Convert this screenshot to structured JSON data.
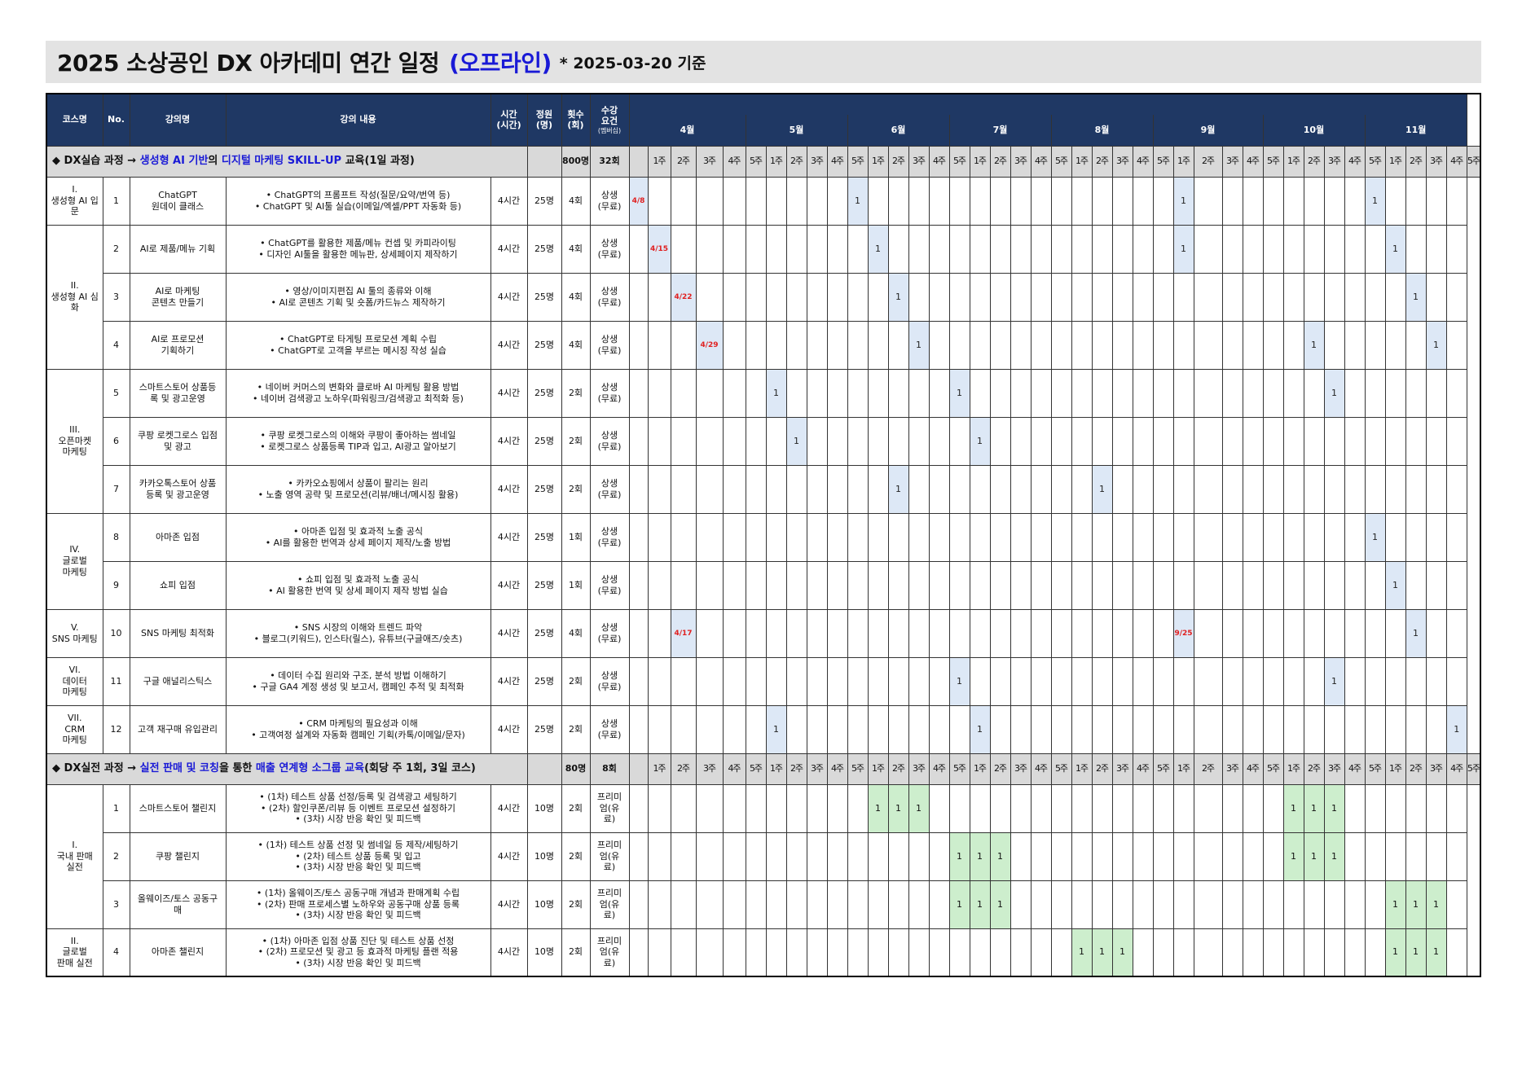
{
  "page": {
    "title": "2025 소상공인 DX 아카데미 연간 일정",
    "title_accent": "(오프라인)",
    "note": "* 2025-03-20 기준",
    "accent_color": "#1a1ad6"
  },
  "headers": {
    "course": "코스명",
    "no": "No.",
    "lecture": "강의명",
    "content": "강의 내용",
    "hours": "시간\n(시간)",
    "capacity": "정원\n(명)",
    "count": "횟수\n(회)",
    "req": "수강\n요건",
    "req_sub": "(멤버십)",
    "months": [
      "4월",
      "5월",
      "6월",
      "7월",
      "8월",
      "9월",
      "10월",
      "11월"
    ],
    "weeks": [
      "1주",
      "2주",
      "3주",
      "4주",
      "5주",
      "1주",
      "2주",
      "3주",
      "4주",
      "5주",
      "1주",
      "2주",
      "3주",
      "4주",
      "5주",
      "1주",
      "2주",
      "3주",
      "4주",
      "5주",
      "1주",
      "2주",
      "3주",
      "4주",
      "5주",
      "1주",
      "2주",
      "3주",
      "4주",
      "5주",
      "1주",
      "2주",
      "3주",
      "4주",
      "5주",
      "1주",
      "2주",
      "3주",
      "4주",
      "5주"
    ]
  },
  "section1": {
    "prefix": "◆ DX실습 과정 → ",
    "blue1": "생성형 AI 기반",
    "mid": "의 ",
    "blue2": "디지털 마케팅 SKILL-UP",
    "suffix": " 교육(1일 과정)",
    "capacity": "800명",
    "count": "32회"
  },
  "section2": {
    "prefix": "◆ DX실전 과정 → ",
    "blue1": "실전 판매 및 코칭",
    "mid": "을 통한 ",
    "blue2": "매출 연계형 소그룹 교육",
    "suffix": "(회당 주 1회, 3일 코스)",
    "capacity": "80명",
    "count": "8회"
  },
  "rows1": [
    {
      "course": "I.\n생성형 AI 입문",
      "span": 1,
      "no": "1",
      "name": "ChatGPT\n원데이 클래스",
      "content": "• ChatGPT의 프롬프트 작성(질문/요약/번역 등)\n• ChatGPT 및 AI툴 실습(이메일/엑셀/PPT 자동화 등)",
      "hours": "4시간",
      "cap": "25명",
      "cnt": "4회",
      "req": "상생\n(무료)",
      "marks": [
        [
          1,
          "4/8"
        ],
        [
          11,
          "1"
        ],
        [
          27,
          "1"
        ],
        [
          36,
          "1"
        ]
      ]
    },
    {
      "course": "II.\n생성형 AI 심화",
      "span": 3,
      "no": "2",
      "name": "AI로 제품/메뉴 기획",
      "content": "• ChatGPT를 활용한 제품/메뉴 컨셉 및 카피라이팅\n• 디자인 AI툴을 활용한 메뉴판, 상세페이지 제작하기",
      "hours": "4시간",
      "cap": "25명",
      "cnt": "4회",
      "req": "상생\n(무료)",
      "marks": [
        [
          2,
          "4/15"
        ],
        [
          12,
          "1"
        ],
        [
          27,
          "1"
        ],
        [
          37,
          "1"
        ]
      ]
    },
    {
      "no": "3",
      "name": "AI로 마케팅\n콘텐츠 만들기",
      "content": "• 영상/이미지편집 AI 툴의 종류와 이해\n• AI로 콘텐츠 기획 및 숏폼/카드뉴스 제작하기",
      "hours": "4시간",
      "cap": "25명",
      "cnt": "4회",
      "req": "상생\n(무료)",
      "marks": [
        [
          3,
          "4/22"
        ],
        [
          13,
          "1"
        ],
        [
          38,
          "1"
        ]
      ]
    },
    {
      "no": "4",
      "name": "AI로 프로모션\n기획하기",
      "content": "• ChatGPT로 타게팅 프로모션 계획 수립\n• ChatGPT로 고객을 부르는 메시징 작성 실습",
      "hours": "4시간",
      "cap": "25명",
      "cnt": "4회",
      "req": "상생\n(무료)",
      "marks": [
        [
          4,
          "4/29"
        ],
        [
          14,
          "1"
        ],
        [
          33,
          "1"
        ],
        [
          39,
          "1"
        ]
      ]
    },
    {
      "course": "III.\n오픈마켓\n마케팅",
      "span": 3,
      "no": "5",
      "name": "스마트스토어 상품등\n록 및 광고운영",
      "content": "• 네이버 커머스의 변화와 클로바 AI 마케팅 활용 방법\n• 네이버 검색광고 노하우(파워링크/검색광고 최적화 등)",
      "hours": "4시간",
      "cap": "25명",
      "cnt": "2회",
      "req": "상생\n(무료)",
      "marks": [
        [
          7,
          "1"
        ],
        [
          16,
          "1"
        ],
        [
          34,
          "1"
        ]
      ]
    },
    {
      "no": "6",
      "name": "쿠팡 로켓그로스 입점\n및 광고",
      "content": "• 쿠팡 로켓그로스의 이해와 쿠팡이 좋아하는 썸네일\n• 로켓그로스 상품등록 TIP과 입고, AI광고 알아보기",
      "hours": "4시간",
      "cap": "25명",
      "cnt": "2회",
      "req": "상생\n(무료)",
      "marks": [
        [
          8,
          "1"
        ],
        [
          17,
          "1"
        ]
      ]
    },
    {
      "no": "7",
      "name": "카카오톡스토어 상품\n등록 및 광고운영",
      "content": "• 카카오쇼핑에서 상품이 팔리는 원리\n• 노출 영역 공략 및 프로모션(리뷰/배너/메시징 활용)",
      "hours": "4시간",
      "cap": "25명",
      "cnt": "2회",
      "req": "상생\n(무료)",
      "marks": [
        [
          13,
          "1"
        ],
        [
          23,
          "1"
        ]
      ]
    },
    {
      "course": "IV.\n글로벌\n마케팅",
      "span": 2,
      "no": "8",
      "name": "아마존 입점",
      "content": "• 아마존 입점 및 효과적 노출 공식\n• AI를 활용한 번역과 상세 페이지 제작/노출 방법",
      "hours": "4시간",
      "cap": "25명",
      "cnt": "1회",
      "req": "상생\n(무료)",
      "marks": [
        [
          36,
          "1"
        ]
      ]
    },
    {
      "no": "9",
      "name": "쇼피 입점",
      "content": "• 쇼피 입점 및 효과적 노출 공식\n• AI 활용한 번역 및 상세 페이지 제작 방법 실습",
      "hours": "4시간",
      "cap": "25명",
      "cnt": "1회",
      "req": "상생\n(무료)",
      "marks": [
        [
          37,
          "1"
        ]
      ]
    },
    {
      "course": "V.\nSNS 마케팅",
      "span": 1,
      "no": "10",
      "name": "SNS 마케팅 최적화",
      "content": "• SNS 시장의 이해와 트렌드 파악\n• 블로그(키워드), 인스타(릴스), 유튜브(구글애즈/숏츠)",
      "hours": "4시간",
      "cap": "25명",
      "cnt": "4회",
      "req": "상생\n(무료)",
      "marks": [
        [
          3,
          "4/17"
        ],
        [
          27,
          "9/25"
        ],
        [
          38,
          "1"
        ]
      ]
    },
    {
      "course": "VI.\n데이터\n마케팅",
      "span": 1,
      "no": "11",
      "name": "구글 애널리스틱스",
      "content": "• 데이터 수집 원리와 구조, 분석 방법 이해하기\n• 구글 GA4 계정 생성 및 보고서, 캠페인 추적 및 최적화",
      "hours": "4시간",
      "cap": "25명",
      "cnt": "2회",
      "req": "상생\n(무료)",
      "marks": [
        [
          16,
          "1"
        ],
        [
          34,
          "1"
        ]
      ]
    },
    {
      "course": "VII.\nCRM\n마케팅",
      "span": 1,
      "no": "12",
      "name": "고객 재구매 유입관리",
      "content": "• CRM 마케팅의 필요성과 이해\n• 고객여정 설계와 자동화 캠페인 기획(카톡/이메일/문자)",
      "hours": "4시간",
      "cap": "25명",
      "cnt": "2회",
      "req": "상생\n(무료)",
      "marks": [
        [
          7,
          "1"
        ],
        [
          17,
          "1"
        ],
        [
          40,
          "1"
        ]
      ]
    }
  ],
  "rows2": [
    {
      "course": "I.\n국내 판매\n실전",
      "span": 3,
      "no": "1",
      "name": "스마트스토어 챌린지",
      "content": "• (1차) 테스트 상품 선정/등록 및 검색광고 세팅하기\n• (2차) 할인쿠폰/리뷰 등 이벤트 프로모션 설정하기\n• (3차) 시장 반응 확인 및 피드백",
      "hours": "4시간",
      "cap": "10명",
      "cnt": "2회",
      "req": "프리미\n엄(유\n료)",
      "marks": [
        [
          12,
          "1"
        ],
        [
          13,
          "1"
        ],
        [
          14,
          "1"
        ],
        [
          32,
          "1"
        ],
        [
          33,
          "1"
        ],
        [
          34,
          "1"
        ]
      ]
    },
    {
      "no": "2",
      "name": "쿠팡 챌린지",
      "content": "• (1차) 테스트 상품 선정 및 썸네일 등 제작/세팅하기\n• (2차) 테스트 상품 등록 및 입고\n• (3차) 시장 반응 확인 및 피드백",
      "hours": "4시간",
      "cap": "10명",
      "cnt": "2회",
      "req": "프리미\n엄(유\n료)",
      "marks": [
        [
          16,
          "1"
        ],
        [
          17,
          "1"
        ],
        [
          18,
          "1"
        ],
        [
          32,
          "1"
        ],
        [
          33,
          "1"
        ],
        [
          34,
          "1"
        ]
      ]
    },
    {
      "no": "3",
      "name": "올웨이즈/토스 공동구\n매",
      "content": "• (1차) 올웨이즈/토스 공동구매 개념과 판매계획 수립\n• (2차) 판매 프로세스별 노하우와 공동구매 상품 등록\n• (3차) 시장 반응 확인 및 피드백",
      "hours": "4시간",
      "cap": "10명",
      "cnt": "2회",
      "req": "프리미\n엄(유\n료)",
      "marks": [
        [
          16,
          "1"
        ],
        [
          17,
          "1"
        ],
        [
          18,
          "1"
        ],
        [
          37,
          "1"
        ],
        [
          38,
          "1"
        ],
        [
          39,
          "1"
        ]
      ]
    },
    {
      "course": "II.\n글로벌\n판매 실전",
      "span": 1,
      "no": "4",
      "name": "아마존 챌린지",
      "content": "• (1차) 아마존 입점 상품 진단 및 테스트 상품 선정\n• (2차) 프로모션 및 광고 등 효과적 마케팅 플랜 적용\n• (3차) 시장 반응 확인 및 피드백",
      "hours": "4시간",
      "cap": "10명",
      "cnt": "2회",
      "req": "프리미\n엄(유\n료)",
      "marks": [
        [
          22,
          "1"
        ],
        [
          23,
          "1"
        ],
        [
          24,
          "1"
        ],
        [
          37,
          "1"
        ],
        [
          38,
          "1"
        ],
        [
          39,
          "1"
        ]
      ]
    }
  ]
}
